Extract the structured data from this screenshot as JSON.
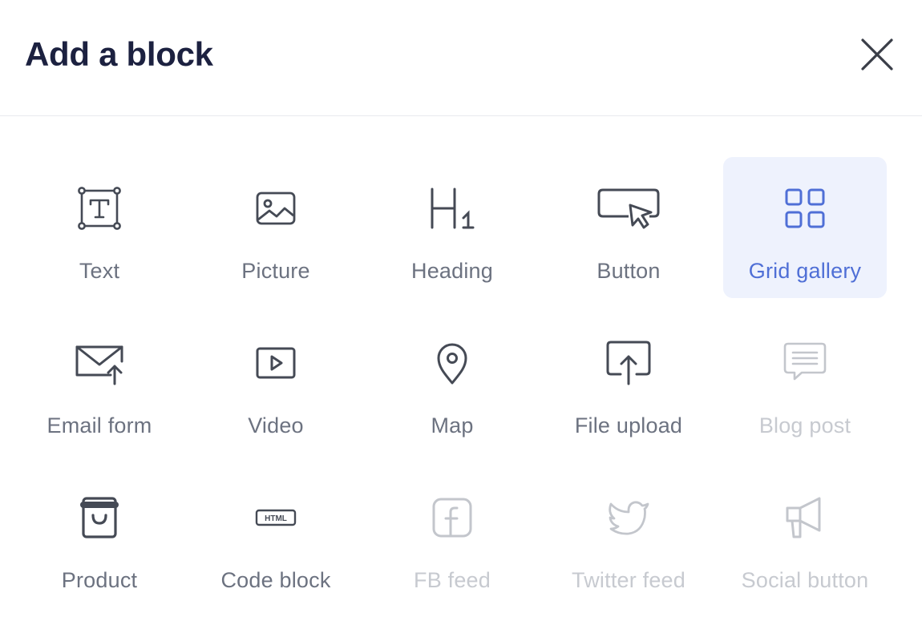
{
  "dialog": {
    "title": "Add a block",
    "close_icon": "close-icon"
  },
  "blocks": [
    {
      "label": "Text",
      "icon": "text-icon",
      "state": "normal"
    },
    {
      "label": "Picture",
      "icon": "picture-icon",
      "state": "normal"
    },
    {
      "label": "Heading",
      "icon": "heading-icon",
      "state": "normal"
    },
    {
      "label": "Button",
      "icon": "button-icon",
      "state": "normal"
    },
    {
      "label": "Grid gallery",
      "icon": "grid-gallery-icon",
      "state": "selected"
    },
    {
      "label": "Email form",
      "icon": "email-form-icon",
      "state": "normal"
    },
    {
      "label": "Video",
      "icon": "video-icon",
      "state": "normal"
    },
    {
      "label": "Map",
      "icon": "map-pin-icon",
      "state": "normal"
    },
    {
      "label": "File upload",
      "icon": "file-upload-icon",
      "state": "normal"
    },
    {
      "label": "Blog post",
      "icon": "blog-post-icon",
      "state": "disabled"
    },
    {
      "label": "Product",
      "icon": "product-bag-icon",
      "state": "normal"
    },
    {
      "label": "Code block",
      "icon": "html-code-icon",
      "state": "normal"
    },
    {
      "label": "FB feed",
      "icon": "facebook-icon",
      "state": "disabled"
    },
    {
      "label": "Twitter feed",
      "icon": "twitter-icon",
      "state": "disabled"
    },
    {
      "label": "Social button",
      "icon": "megaphone-icon",
      "state": "disabled"
    }
  ],
  "icon_labels": {
    "html": "HTML",
    "heading_h": "H",
    "heading_sub": "1"
  },
  "colors": {
    "title": "#1c2140",
    "accent": "#4f6fd6",
    "selected_bg": "#eef2fd",
    "icon_default": "#454a55",
    "icon_disabled": "#c3c6cc"
  }
}
